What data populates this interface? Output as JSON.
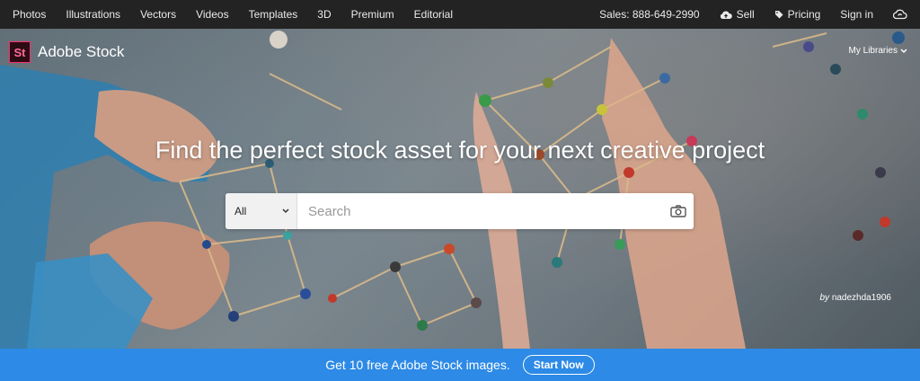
{
  "topnav": {
    "links": [
      "Photos",
      "Illustrations",
      "Vectors",
      "Videos",
      "Templates",
      "3D",
      "Premium",
      "Editorial"
    ],
    "sales": "Sales: 888-649-2990",
    "sell": "Sell",
    "pricing": "Pricing",
    "signin": "Sign in"
  },
  "brand": {
    "logo": "St",
    "name": "Adobe Stock"
  },
  "my_libraries": "My Libraries",
  "hero": {
    "headline": "Find the perfect stock asset for your next creative project"
  },
  "search": {
    "category": "All",
    "placeholder": "Search"
  },
  "credit": {
    "prefix": "by",
    "author": "nadezhda1906"
  },
  "banner": {
    "text": "Get 10 free Adobe Stock images.",
    "button": "Start Now"
  },
  "colors": {
    "nav_bg": "#232323",
    "banner_bg": "#2d8ae6",
    "logo_border": "#ff2b6a"
  },
  "icons": [
    "cloud-upload-icon",
    "tag-icon",
    "creative-cloud-icon",
    "chevron-down-icon",
    "camera-icon"
  ]
}
